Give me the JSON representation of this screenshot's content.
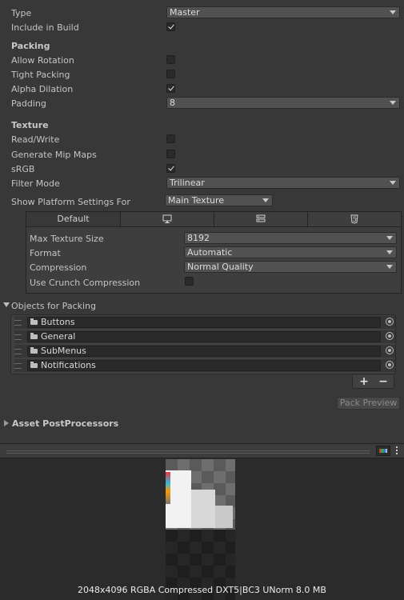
{
  "top": {
    "type_label": "Type",
    "type_value": "Master",
    "include_label": "Include in Build",
    "include_checked": true
  },
  "packing": {
    "header": "Packing",
    "allow_rotation_label": "Allow Rotation",
    "allow_rotation_checked": false,
    "tight_packing_label": "Tight Packing",
    "tight_packing_checked": false,
    "alpha_dilation_label": "Alpha Dilation",
    "alpha_dilation_checked": true,
    "padding_label": "Padding",
    "padding_value": "8"
  },
  "texture": {
    "header": "Texture",
    "read_write_label": "Read/Write",
    "read_write_checked": false,
    "mipmaps_label": "Generate Mip Maps",
    "mipmaps_checked": false,
    "srgb_label": "sRGB",
    "srgb_checked": true,
    "filter_mode_label": "Filter Mode",
    "filter_mode_value": "Trilinear"
  },
  "platform": {
    "show_label": "Show Platform Settings For",
    "show_value": "Main Texture",
    "tabs": [
      {
        "label": "Default",
        "icon": "default-tab"
      },
      {
        "label": "",
        "icon": "monitor-icon"
      },
      {
        "label": "",
        "icon": "server-icon"
      },
      {
        "label": "",
        "icon": "html5-icon"
      }
    ],
    "max_size_label": "Max Texture Size",
    "max_size_value": "8192",
    "format_label": "Format",
    "format_value": "Automatic",
    "compression_label": "Compression",
    "compression_value": "Normal Quality",
    "crunch_label": "Use Crunch Compression",
    "crunch_checked": false
  },
  "objects": {
    "header": "Objects for Packing",
    "items": [
      "Buttons",
      "General",
      "SubMenus",
      "Notifications"
    ],
    "add_label": "+",
    "remove_label": "−"
  },
  "pack_preview_label": "Pack Preview",
  "asset_post_label": "Asset PostProcessors",
  "preview_info": "2048x4096 RGBA Compressed DXT5|BC3 UNorm   8.0 MB"
}
